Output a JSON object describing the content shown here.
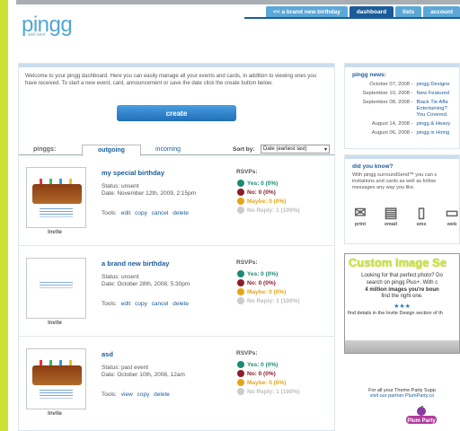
{
  "app": {
    "logo": "pingg",
    "logo_sub": "well sent"
  },
  "nav": {
    "tabs": [
      {
        "label": "<< a brand new birthday"
      },
      {
        "label": "dashboard"
      },
      {
        "label": "lists"
      },
      {
        "label": "account"
      }
    ]
  },
  "welcome": {
    "text": "Welcome to your pingg dashboard. Here you can easily manage all your events and cards, in addition to viewing ones you have received. To start a new event, card, announcement or save the date click the create button below."
  },
  "create": {
    "label": "create"
  },
  "tabs": {
    "pinggs_label": "pinggs:",
    "outgoing": "outgoing",
    "incoming": "incoming",
    "sort_label": "Sort by:",
    "sort_value": "Date (earliest last)"
  },
  "events": [
    {
      "name": "my special birthday",
      "status": "Status: unsent",
      "date": "Date: November 12th, 2009, 2:15pm",
      "tools_label": "Tools:",
      "tools": [
        "edit",
        "copy",
        "cancel",
        "delete"
      ],
      "invite": "Invite",
      "rsvp_label": "RSVPs:",
      "rsvps": [
        "Yes: 0 (0%)",
        "No: 0 (0%)",
        "Maybe: 0 (0%)",
        "No Reply: 1 (100%)"
      ]
    },
    {
      "name": "a brand new birthday",
      "status": "Status: unsent",
      "date": "Date: October 28th, 2008, 5:30pm",
      "tools_label": "Tools:",
      "tools": [
        "edit",
        "copy",
        "cancel",
        "delete"
      ],
      "invite": "Invite",
      "rsvp_label": "RSVPs:",
      "rsvps": [
        "Yes: 0 (0%)",
        "No: 0 (0%)",
        "Maybe: 0 (0%)",
        "No Reply: 1 (100%)"
      ]
    },
    {
      "name": "asd",
      "status": "Status: past event",
      "date": "Date: October 10th, 2008, 12am",
      "tools_label": "Tools:",
      "tools": [
        "view",
        "copy",
        "delete"
      ],
      "invite": "Invite",
      "rsvp_label": "RSVPs:",
      "rsvps": [
        "Yes: 0 (0%)",
        "No: 0 (0%)",
        "Maybe: 0 (0%)",
        "No Reply: 1 (100%)"
      ]
    }
  ],
  "news": {
    "title": "pingg news:",
    "items": [
      {
        "date": "October 07, 2008",
        "text": "pingg Designe"
      },
      {
        "date": "September 10, 2008",
        "text": "New Featured"
      },
      {
        "date": "September 08, 2008",
        "text": "Black Tie Affa"
      },
      {
        "date": "",
        "text": "Entertaining?"
      },
      {
        "date": "",
        "text": "You Covered."
      },
      {
        "date": "August 14, 2008",
        "text": "pingg & Heavy"
      },
      {
        "date": "August 06, 2008",
        "text": "pingg is Hiring"
      }
    ]
  },
  "dyk": {
    "title": "did you know?",
    "text": "With pingg surroundSend™ you can s invitations and cards as well as follow messages any way you like.",
    "icons": [
      {
        "label": "print",
        "icon": "envelope-icon"
      },
      {
        "label": "email",
        "icon": "document-icon"
      },
      {
        "label": "sms",
        "icon": "phone-icon"
      },
      {
        "label": "web",
        "icon": "monitor-icon"
      }
    ]
  },
  "ad": {
    "title": "Custom Image Se",
    "line1": "Looking for that perfect photo? Do",
    "line2": "search on pingg Plus+. With c",
    "line3": "4 million images you're boun",
    "line4": "find the right one.",
    "stars": "★★★",
    "bottom": "find details in the Invite Design section of th"
  },
  "footer": {
    "line1": "For all your Theme Party Supp",
    "line2": "visit our partner PlumParty.co",
    "logo": "Plum Party"
  },
  "colors": {
    "yes": "#1c8a74",
    "no": "#8c1d2a",
    "maybe": "#e7a41a",
    "noreply": "#bbbbbb",
    "accent": "#1a5c99"
  }
}
